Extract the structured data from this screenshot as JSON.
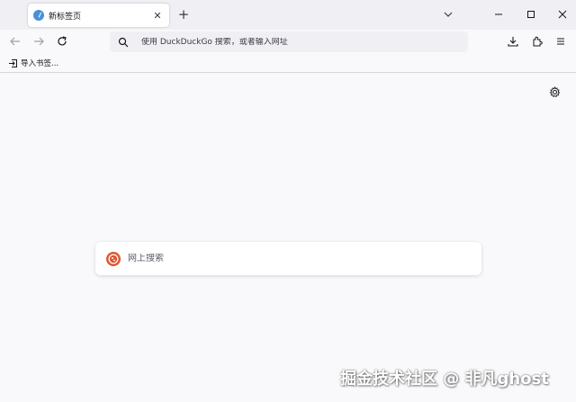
{
  "tab": {
    "title": "新标签页",
    "close": "✕"
  },
  "tabstrip": {
    "new_tab": "+"
  },
  "navbar": {
    "url_placeholder": "使用 DuckDuckGo 搜索，或者输入网址"
  },
  "bookmarks": {
    "import_label": "导入书签..."
  },
  "newtab": {
    "search_placeholder": "网上搜索"
  },
  "watermark": "掘金技术社区 @ 非凡ghost",
  "colors": {
    "accent": "#4a90d9",
    "ddg": "#de5833"
  }
}
